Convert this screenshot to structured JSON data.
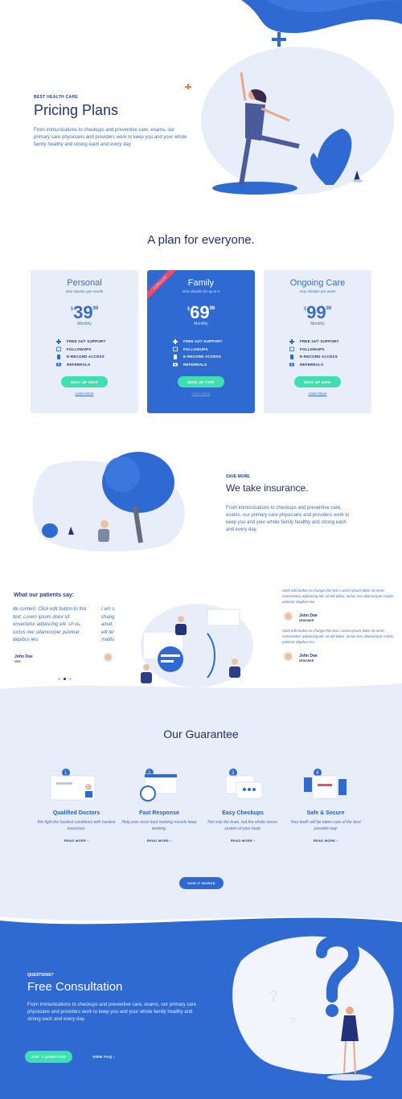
{
  "colors": {
    "brand_blue": "#2f6ad2",
    "dark_navy": "#1f2e6e",
    "accent_green": "#3fe0b0",
    "accent_orange": "#f07a3a",
    "light_bg": "#e8eef9",
    "ribbon_red": "#ef4a68"
  },
  "hero": {
    "eyebrow": "BEST HEALTH CARE",
    "title": "Pricing Plans",
    "description": "From immunizations to checkups and  preventive care,  exams, our primary care physicians and providers work to keep you and your whole family healthy and strong each and every day."
  },
  "plans": {
    "heading": "A plan for everyone.",
    "items": [
      {
        "name": "Personal",
        "subtitle": "One checkin per month",
        "currency": "$",
        "amount": "39",
        "cents": "99",
        "period": "Monthly",
        "features": [
          "FREE 24/7 SUPPORT",
          "FOLLOWUPS",
          "E-RECORD ACCESS",
          "REFERRALS"
        ],
        "cta": "SIGN UP NOW",
        "learn_more": "Learn More"
      },
      {
        "name": "Family",
        "ribbon": "POPULAR",
        "subtitle": "One checkin for up to 5",
        "currency": "$",
        "amount": "69",
        "cents": "99",
        "period": "Monthly",
        "features": [
          "FREE 24/7 SUPPORT",
          "FOLLOWUPS",
          "E-RECORD ACCESS",
          "REFERRALS"
        ],
        "cta": "SIGN UP NOW",
        "learn_more": "Learn More"
      },
      {
        "name": "Ongoing Care",
        "subtitle": "One checkin per week",
        "currency": "$",
        "amount": "99",
        "cents": "99",
        "period": "Monthly",
        "features": [
          "FREE 24/7 SUPPORT",
          "FOLLOWUPS",
          "E-RECORD ACCESS",
          "REFERRALS"
        ],
        "cta": "SIGN UP NOW",
        "learn_more": "Learn More"
      }
    ],
    "feature_icons": [
      "plus-icon",
      "calendar-icon",
      "document-icon",
      "camera-icon"
    ]
  },
  "insurance": {
    "eyebrow": "SAVE MORE",
    "title": "We take insurance.",
    "description": "From immunizations to checkups and  preventive care, exams, our primary care physicians and providers work to keep you and your whole family healthy and strong each and every day."
  },
  "testimonials": {
    "title": "What our patients say:",
    "main_quote": "de content. Click edit button to this text. Lorem ipsum dolor sit onsectetur adipiscing elit. Ut us, luctus nec ullamcorper pulvinar dapibus leo.",
    "main_author": "John Doe",
    "main_role": "CEO",
    "peek_quote": "I am s chang amet, elit tel mattis",
    "side": [
      {
        "quote": "Click edit button to change this text. Lorem ipsum dolor sit amet, consectetur adipiscing elit. Ut elit tellus, luctus nec ullamcorper mattis, pulvinar dapibus leo.",
        "author": "John Doe",
        "role": "DESIGNER"
      },
      {
        "quote": "Click edit button to change this text. Lorem ipsum dolor sit amet, consectetur adipiscing elit. Ut elit tellus, luctus nec ullamcorper mattis, pulvinar dapibus leo.",
        "author": "John Doe",
        "role": "DESIGNER"
      }
    ]
  },
  "guarantee": {
    "title": "Our Guarantee",
    "items": [
      {
        "num": "1",
        "title": "Qualified Doctors",
        "desc": "We fight the hardest conditions with hardest resources.",
        "link": "READ MORE ›"
      },
      {
        "num": "2",
        "title": "Fast Response",
        "desc": "Help your most hard working muscle keep working.",
        "link": "READ MORE ›"
      },
      {
        "num": "3",
        "title": "Easy Checkups",
        "desc": "Not only the brain, but the whole neuro-system of your body.",
        "link": "READ MORE ›"
      },
      {
        "num": "4",
        "title": "Safe & Secure",
        "desc": "Your teeth will be taken care of the best possible way",
        "link": "READ MORE ›"
      }
    ],
    "cta": "HOW IT WORKS"
  },
  "consultation": {
    "eyebrow": "QUESTIONS?",
    "title": "Free Consultation",
    "description": "From immunizations to checkups and  preventive care,  exams, our primary care physicians and providers work to keep you and your whole family healthy and strong each and every day.",
    "ask_button": "ASK A QUESTION",
    "faq_link": "VIEW FAQ  ›"
  }
}
